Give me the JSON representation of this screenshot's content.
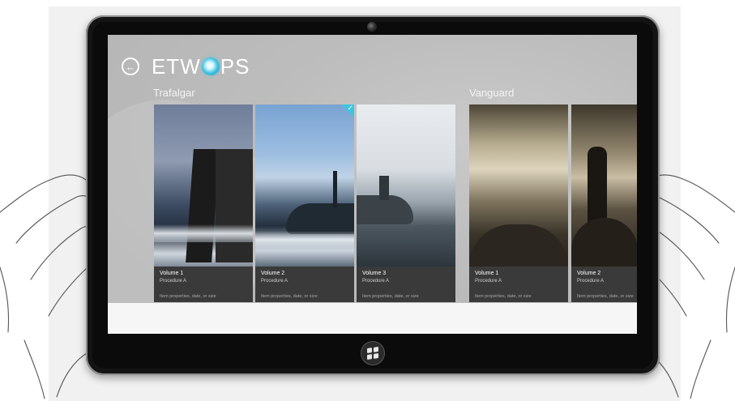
{
  "app": {
    "title_prefix": "ETW",
    "title_suffix": "PS"
  },
  "groups": [
    {
      "label": "Trafalgar",
      "tiles": [
        {
          "title": "Volume 1",
          "subtitle": "Procedure A",
          "meta": "Item properties, date, or size",
          "selected": false
        },
        {
          "title": "Volume 2",
          "subtitle": "Procedure A",
          "meta": "Item properties, date, or size",
          "selected": true
        },
        {
          "title": "Volume 3",
          "subtitle": "Procedure A",
          "meta": "Item properties, date, or size",
          "selected": false
        }
      ]
    },
    {
      "label": "Vanguard",
      "tiles": [
        {
          "title": "Volume 1",
          "subtitle": "Procedure A",
          "meta": "Item properties, date, or size",
          "selected": false
        },
        {
          "title": "Volume 2",
          "subtitle": "Procedure A",
          "meta": "Item properties, date, or size",
          "selected": false
        }
      ]
    }
  ],
  "icons": {
    "back": "back-arrow-icon",
    "check": "checkmark-icon",
    "windows": "windows-logo-icon",
    "camera": "camera-icon"
  },
  "colors": {
    "selection_accent": "#3cc6de",
    "screen_bg": "#bdbdbd",
    "tile_caption_bg": "#3a3a3a",
    "bezel": "#141414"
  }
}
